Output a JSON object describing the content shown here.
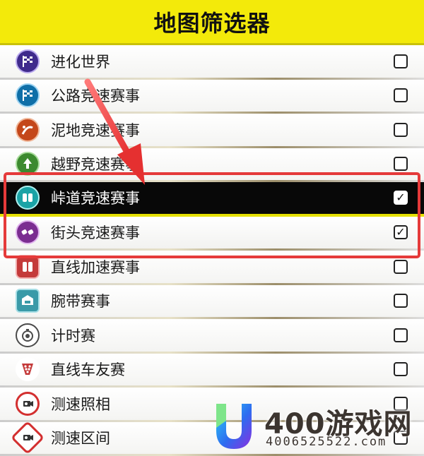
{
  "header": {
    "title": "地图筛选器"
  },
  "filters": [
    {
      "label": "进化世界",
      "icon": "checkered-flag-icon",
      "icon_color": "#3f2a8c",
      "checked": false
    },
    {
      "label": "公路竞速赛事",
      "icon": "checkered-flag-icon",
      "icon_color": "#0f6fa8",
      "checked": false
    },
    {
      "label": "泥地竞速赛事",
      "icon": "dirt-track-icon",
      "icon_color": "#c4471a",
      "checked": false
    },
    {
      "label": "越野竞速赛事",
      "icon": "tree-icon",
      "icon_color": "#3c8a2f",
      "checked": false
    },
    {
      "label": "峠道竞速赛事",
      "icon": "race-cars-icon",
      "icon_color": "#1aa3a6",
      "checked": true
    },
    {
      "label": "街头竞速赛事",
      "icon": "street-cars-icon",
      "icon_color": "#7b2d91",
      "checked": true
    },
    {
      "label": "直线加速赛事",
      "icon": "drag-race-icon",
      "icon_color": "#c43a3a",
      "checked": false
    },
    {
      "label": "腕带赛事",
      "icon": "wristband-icon",
      "icon_color": "#3a9aa8",
      "checked": false
    },
    {
      "label": "计时赛",
      "icon": "stopwatch-icon",
      "icon_color": "#4a4a4a",
      "checked": false
    },
    {
      "label": "直线车友赛",
      "icon": "drag-tree-icon",
      "icon_color": "#c43a3a",
      "checked": false
    },
    {
      "label": "测速照相",
      "icon": "speed-camera-icon",
      "icon_color": "#d32f2f",
      "checked": false
    },
    {
      "label": "测速区间",
      "icon": "speed-zone-icon",
      "icon_color": "#d32f2f",
      "checked": false
    }
  ],
  "check_mark": "✓",
  "watermark": {
    "name": "400游戏网",
    "url": "4006525522.com"
  },
  "colors": {
    "header": "#f3ea0a",
    "highlight": "#e53a3a",
    "selected_row": "#080808",
    "selected_border": "#e5e000"
  }
}
